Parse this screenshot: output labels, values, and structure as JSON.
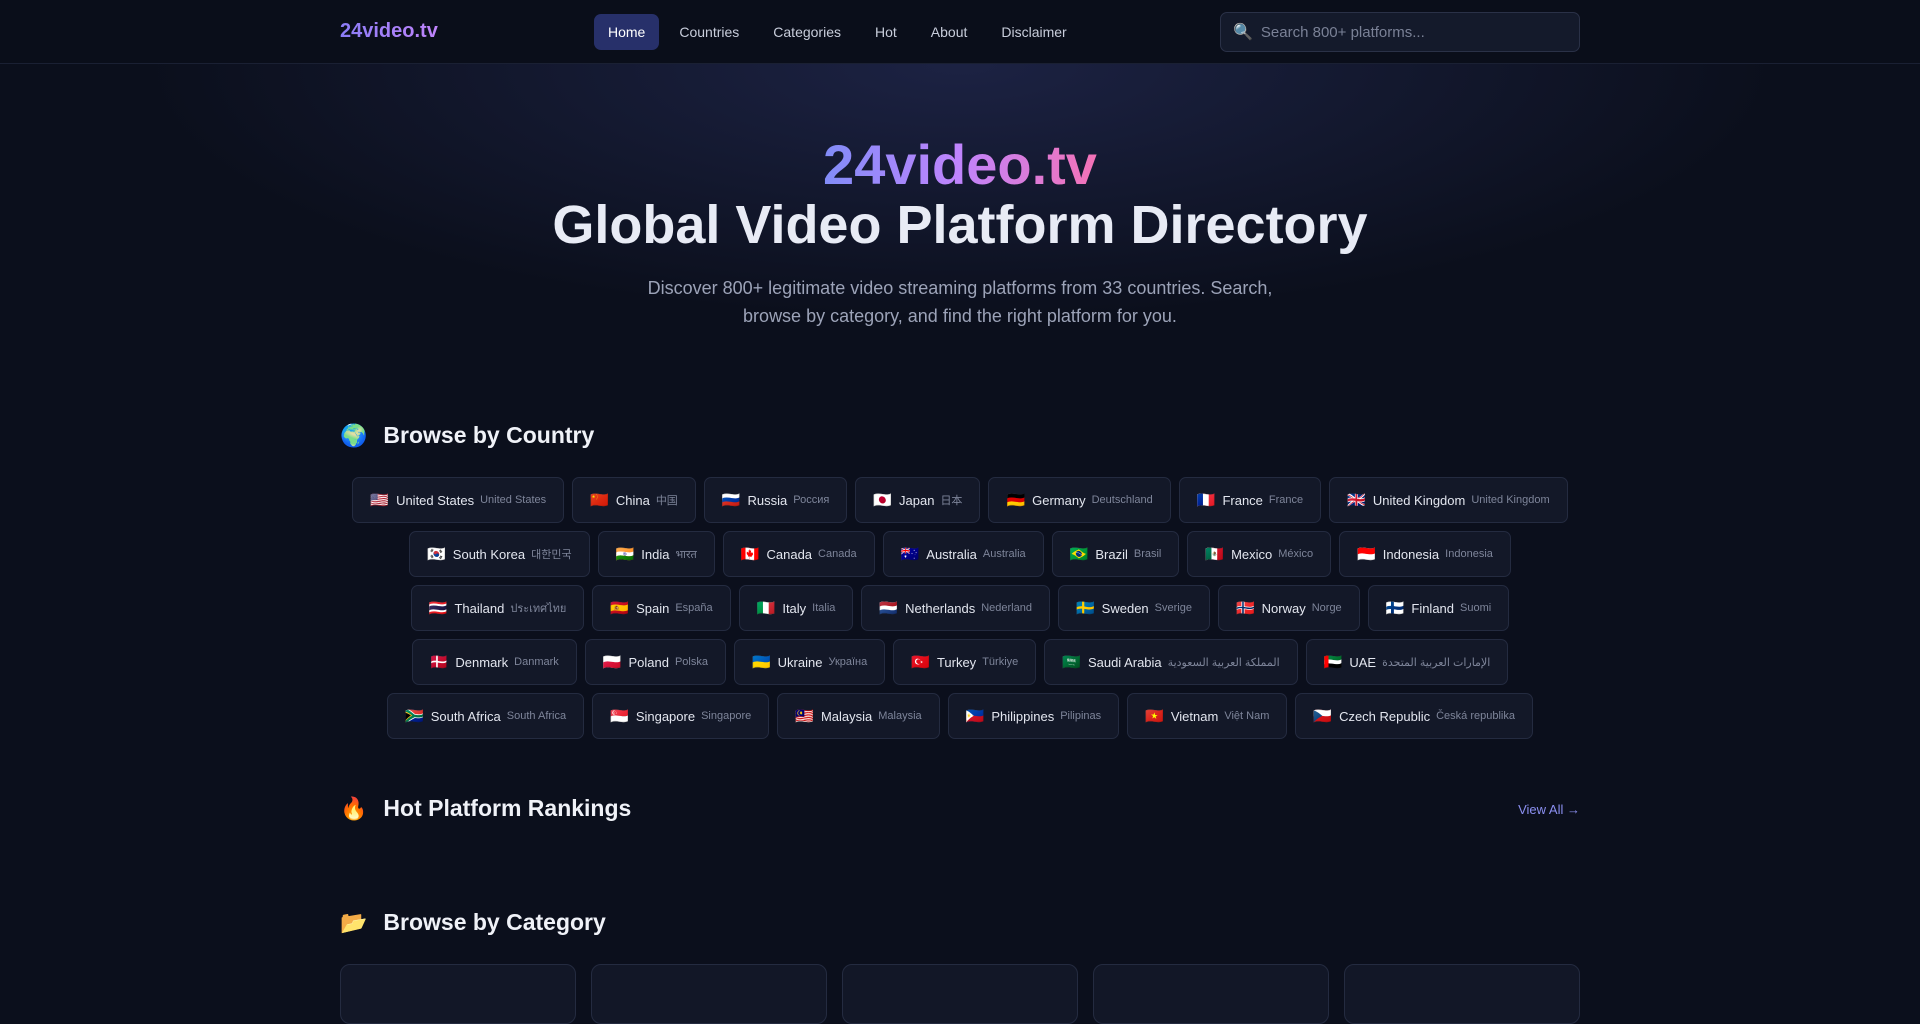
{
  "header": {
    "logo": "24video.tv",
    "nav": [
      "Home",
      "Countries",
      "Categories",
      "Hot",
      "About",
      "Disclaimer"
    ],
    "active_nav": "Home",
    "search_placeholder": "Search 800+ platforms..."
  },
  "hero": {
    "brand": "24video.tv",
    "title": "Global Video Platform Directory",
    "subtitle": "Discover 800+ legitimate video streaming platforms from 33 countries. Search, browse by category, and find the right platform for you."
  },
  "sections": {
    "country": {
      "icon": "🌍",
      "title": "Browse by Country"
    },
    "hot": {
      "icon": "🔥",
      "title": "Hot Platform Rankings",
      "view_all": "View All →"
    },
    "category": {
      "icon": "📂",
      "title": "Browse by Category"
    }
  },
  "countries": [
    {
      "flag": "🇺🇸",
      "name": "United States",
      "native": "United States"
    },
    {
      "flag": "🇨🇳",
      "name": "China",
      "native": "中国"
    },
    {
      "flag": "🇷🇺",
      "name": "Russia",
      "native": "Россия"
    },
    {
      "flag": "🇯🇵",
      "name": "Japan",
      "native": "日本"
    },
    {
      "flag": "🇩🇪",
      "name": "Germany",
      "native": "Deutschland"
    },
    {
      "flag": "🇫🇷",
      "name": "France",
      "native": "France"
    },
    {
      "flag": "🇬🇧",
      "name": "United Kingdom",
      "native": "United Kingdom"
    },
    {
      "flag": "🇰🇷",
      "name": "South Korea",
      "native": "대한민국"
    },
    {
      "flag": "🇮🇳",
      "name": "India",
      "native": "भारत"
    },
    {
      "flag": "🇨🇦",
      "name": "Canada",
      "native": "Canada"
    },
    {
      "flag": "🇦🇺",
      "name": "Australia",
      "native": "Australia"
    },
    {
      "flag": "🇧🇷",
      "name": "Brazil",
      "native": "Brasil"
    },
    {
      "flag": "🇲🇽",
      "name": "Mexico",
      "native": "México"
    },
    {
      "flag": "🇮🇩",
      "name": "Indonesia",
      "native": "Indonesia"
    },
    {
      "flag": "🇹🇭",
      "name": "Thailand",
      "native": "ประเทศไทย"
    },
    {
      "flag": "🇪🇸",
      "name": "Spain",
      "native": "España"
    },
    {
      "flag": "🇮🇹",
      "name": "Italy",
      "native": "Italia"
    },
    {
      "flag": "🇳🇱",
      "name": "Netherlands",
      "native": "Nederland"
    },
    {
      "flag": "🇸🇪",
      "name": "Sweden",
      "native": "Sverige"
    },
    {
      "flag": "🇳🇴",
      "name": "Norway",
      "native": "Norge"
    },
    {
      "flag": "🇫🇮",
      "name": "Finland",
      "native": "Suomi"
    },
    {
      "flag": "🇩🇰",
      "name": "Denmark",
      "native": "Danmark"
    },
    {
      "flag": "🇵🇱",
      "name": "Poland",
      "native": "Polska"
    },
    {
      "flag": "🇺🇦",
      "name": "Ukraine",
      "native": "Україна"
    },
    {
      "flag": "🇹🇷",
      "name": "Turkey",
      "native": "Türkiye"
    },
    {
      "flag": "🇸🇦",
      "name": "Saudi Arabia",
      "native": "المملكة العربية السعودية"
    },
    {
      "flag": "🇦🇪",
      "name": "UAE",
      "native": "الإمارات العربية المتحدة"
    },
    {
      "flag": "🇿🇦",
      "name": "South Africa",
      "native": "South Africa"
    },
    {
      "flag": "🇸🇬",
      "name": "Singapore",
      "native": "Singapore"
    },
    {
      "flag": "🇲🇾",
      "name": "Malaysia",
      "native": "Malaysia"
    },
    {
      "flag": "🇵🇭",
      "name": "Philippines",
      "native": "Pilipinas"
    },
    {
      "flag": "🇻🇳",
      "name": "Vietnam",
      "native": "Việt Nam"
    },
    {
      "flag": "🇨🇿",
      "name": "Czech Republic",
      "native": "Česká republika"
    }
  ]
}
